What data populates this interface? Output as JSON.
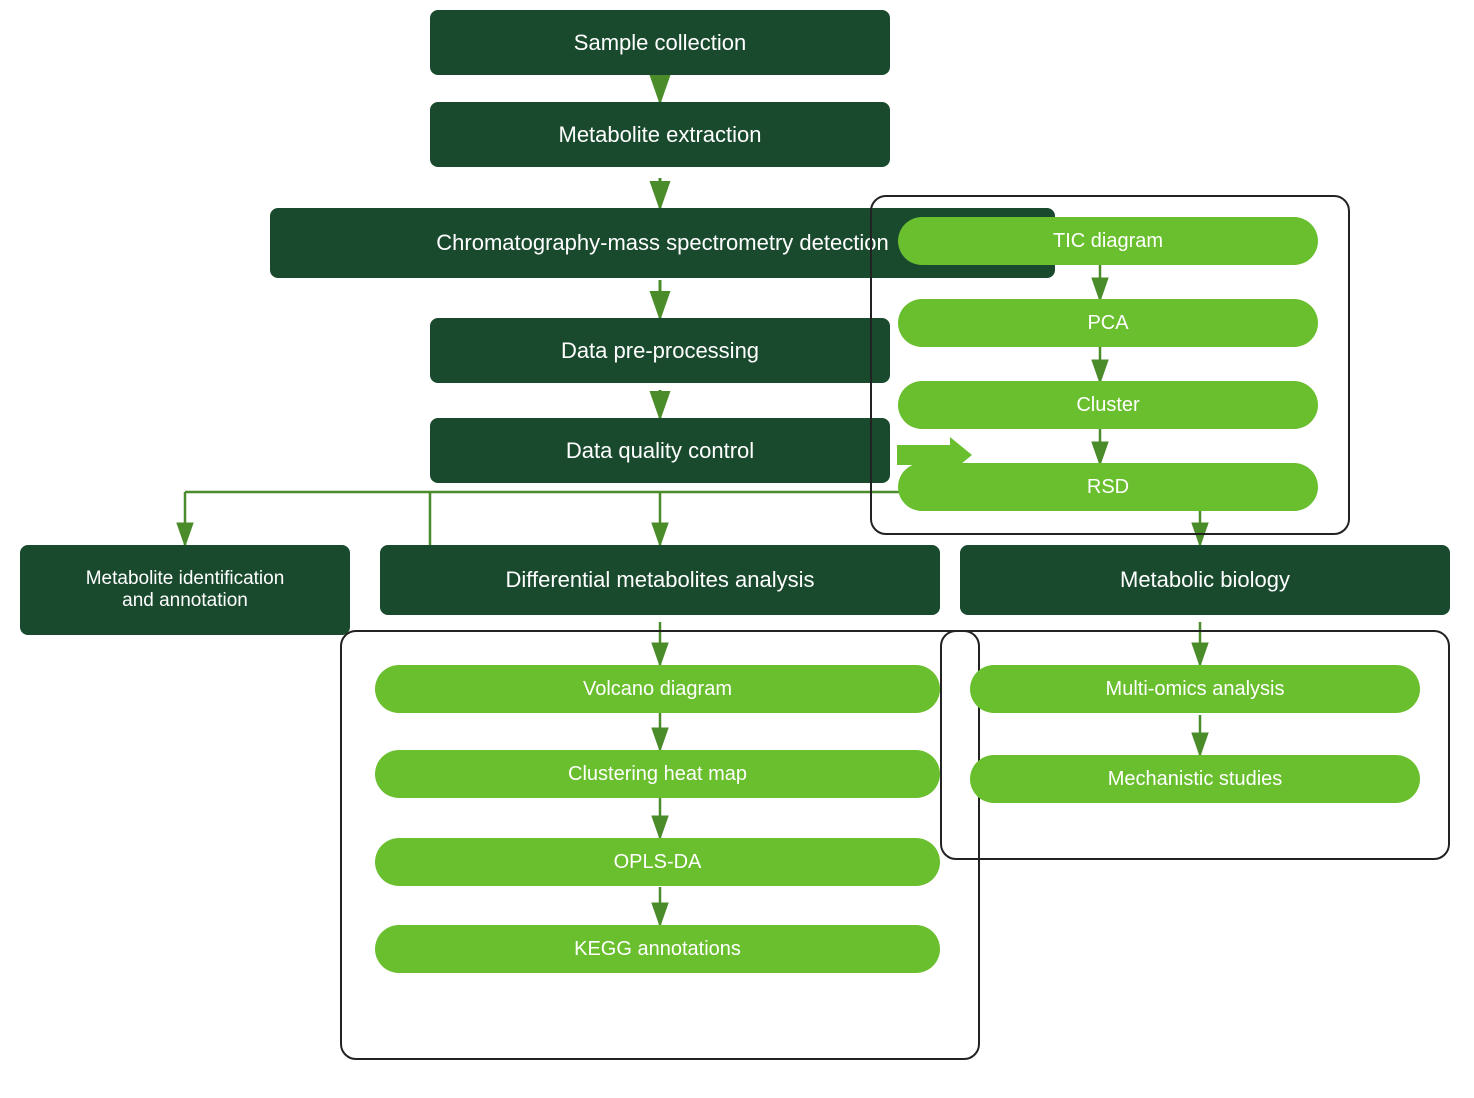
{
  "nodes": {
    "sample_collection": {
      "label": "Sample collection"
    },
    "metabolite_extraction": {
      "label": "Metabolite extraction"
    },
    "chromatography": {
      "label": "Chromatography-mass spectrometry detection"
    },
    "data_preprocessing": {
      "label": "Data pre-processing"
    },
    "data_quality": {
      "label": "Data quality control"
    },
    "metabolite_id": {
      "label": "Metabolite identification\nand annotation"
    },
    "differential": {
      "label": "Differential metabolites analysis"
    },
    "metabolic_biology": {
      "label": "Metabolic biology"
    },
    "tic": {
      "label": "TIC diagram"
    },
    "pca": {
      "label": "PCA"
    },
    "cluster": {
      "label": "Cluster"
    },
    "rsd": {
      "label": "RSD"
    },
    "volcano": {
      "label": "Volcano diagram"
    },
    "clustering_heatmap": {
      "label": "Clustering heat map"
    },
    "opls_da": {
      "label": "OPLS-DA"
    },
    "kegg": {
      "label": "KEGG annotations"
    },
    "multi_omics": {
      "label": "Multi-omics analysis"
    },
    "mechanistic": {
      "label": "Mechanistic studies"
    }
  }
}
